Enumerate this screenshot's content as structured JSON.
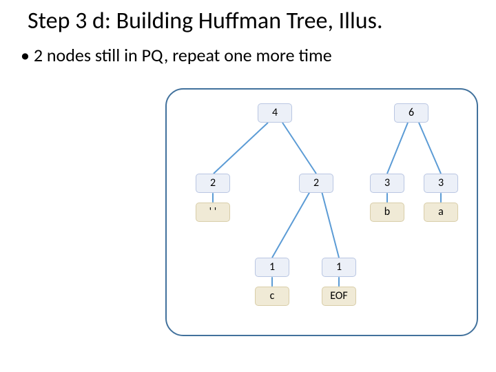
{
  "title": "Step 3 d: Building Huffman Tree, Illus.",
  "bullet": "2 nodes still in PQ, repeat one more time",
  "nodes": {
    "root4": "4",
    "root6": "6",
    "l2a": "2",
    "l2b": "2",
    "l2c": "3",
    "l2d": "3",
    "sp": "' '",
    "b": "b",
    "a": "a",
    "one_l": "1",
    "one_r": "1",
    "c": "c",
    "eof": "EOF"
  },
  "chart_data": {
    "type": "tree",
    "description": "Partial Huffman tree during construction; two roots (weights 4 and 6) remain in the priority queue.",
    "trees": [
      {
        "frequency": 4,
        "children": [
          {
            "frequency": 2,
            "symbol": "' '"
          },
          {
            "frequency": 2,
            "children": [
              {
                "frequency": 1,
                "symbol": "c"
              },
              {
                "frequency": 1,
                "symbol": "EOF"
              }
            ]
          }
        ]
      },
      {
        "frequency": 6,
        "children": [
          {
            "frequency": 3,
            "symbol": "b"
          },
          {
            "frequency": 3,
            "symbol": "a"
          }
        ]
      }
    ]
  }
}
